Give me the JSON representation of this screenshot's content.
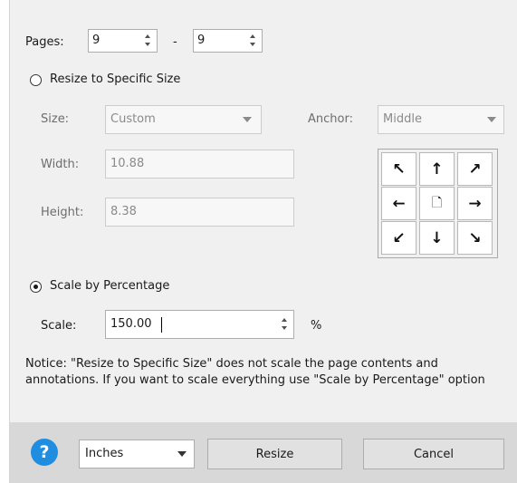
{
  "pages": {
    "label": "Pages:",
    "from": "9",
    "separator": "-",
    "to": "9"
  },
  "resize_option": {
    "label": "Resize to Specific Size",
    "selected": false
  },
  "size": {
    "label": "Size:",
    "value": "Custom"
  },
  "anchor": {
    "label": "Anchor:",
    "value": "Middle",
    "cells": [
      "↖",
      "↑",
      "↗",
      "←",
      "🗋",
      "→",
      "↙",
      "↓",
      "↘"
    ],
    "cell_icons": [
      "arrow-up-left-icon",
      "arrow-up-icon",
      "arrow-up-right-icon",
      "arrow-left-icon",
      "page-icon",
      "arrow-right-icon",
      "arrow-down-left-icon",
      "arrow-down-icon",
      "arrow-down-right-icon"
    ]
  },
  "width": {
    "label": "Width:",
    "value": "10.88"
  },
  "height": {
    "label": "Height:",
    "value": "8.38"
  },
  "scale_option": {
    "label": "Scale by Percentage",
    "selected": true
  },
  "scale": {
    "label": "Scale:",
    "value": "150.00",
    "unit": "%"
  },
  "notice": "Notice: \"Resize to Specific Size\" does not scale the page contents and annotations. If you want to scale everything use \"Scale by Percentage\" option",
  "footer": {
    "help_glyph": "?",
    "units": "Inches",
    "resize_label": "Resize",
    "cancel_label": "Cancel"
  },
  "colors": {
    "help_blue": "#1f8ee0",
    "dialog_bg": "#f0f0f0",
    "footer_bg": "#d8d8d8"
  }
}
